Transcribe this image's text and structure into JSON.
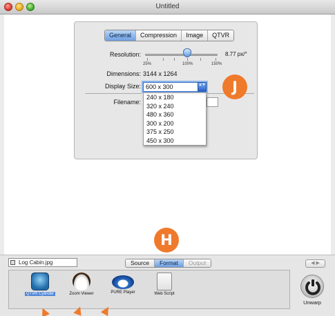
{
  "window": {
    "title": "Untitled"
  },
  "tabs": [
    {
      "label": "General",
      "active": true
    },
    {
      "label": "Compression",
      "active": false
    },
    {
      "label": "Image",
      "active": false
    },
    {
      "label": "QTVR",
      "active": false
    }
  ],
  "general": {
    "resolution_label": "Resolution:",
    "resolution_value": "8.77 px/°",
    "resolution_tick_labels": [
      "25%",
      "100%",
      "150%"
    ],
    "dimensions_label": "Dimensions:",
    "dimensions_value": "3144 x 1264",
    "display_size_label": "Display Size:",
    "display_size_value": "600 x 300",
    "display_size_options": [
      "240 x 180",
      "320 x 240",
      "480 x 360",
      "300 x 200",
      "375 x 250",
      "450 x 300"
    ],
    "filename_label": "Filename:"
  },
  "annotations": {
    "badge_j": "J",
    "badge_h": "H",
    "accent": "#ef7a2b"
  },
  "bottom": {
    "source_file": "Log Cabin.jpg",
    "segments": [
      {
        "label": "Source",
        "active": false
      },
      {
        "label": "Format",
        "active": true
      },
      {
        "label": "Output",
        "active": false
      }
    ],
    "nav_arrows": "◀ ▶",
    "formats": [
      {
        "label": "QTVR Cylinder",
        "icon": "qtvr-cylinder-icon",
        "selected": true
      },
      {
        "label": "Zoom Viewer",
        "icon": "zoom-viewer-icon",
        "selected": false,
        "icon_text": "Zoom"
      },
      {
        "label": "PURE Player",
        "icon": "pure-player-icon",
        "selected": false,
        "icon_text": "PURE"
      },
      {
        "label": "Web Script",
        "icon": "web-script-icon",
        "selected": false
      }
    ],
    "unwarp_label": "Unwarp"
  }
}
